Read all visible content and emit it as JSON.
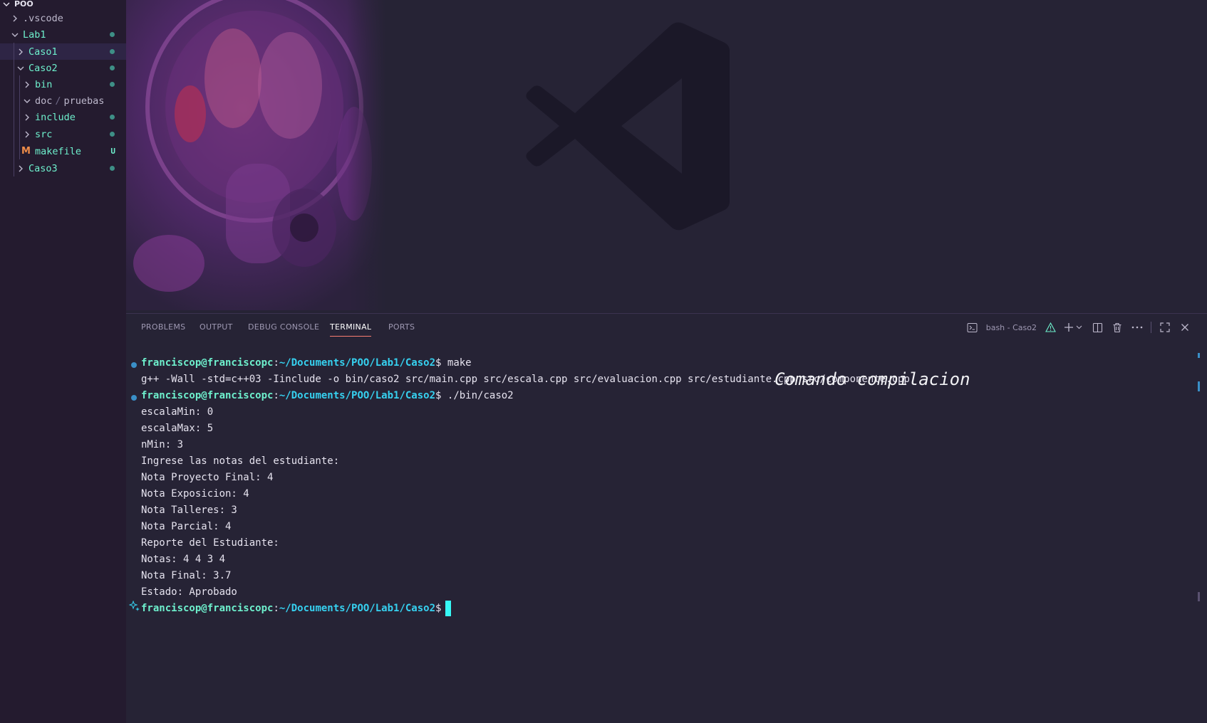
{
  "explorer": {
    "root": "POO",
    "items": [
      {
        "label": ".vscode",
        "kind": "folder",
        "expanded": false,
        "dim": true,
        "badge": ""
      },
      {
        "label": "Lab1",
        "kind": "folder",
        "expanded": true,
        "dim": false,
        "badge": "dot"
      },
      {
        "label": "Caso1",
        "kind": "folder",
        "expanded": false,
        "dim": false,
        "badge": "dot"
      },
      {
        "label": "Caso2",
        "kind": "folder",
        "expanded": true,
        "dim": false,
        "badge": "dot"
      },
      {
        "label": "bin",
        "kind": "folder",
        "expanded": false,
        "dim": false,
        "badge": "dot"
      },
      {
        "label": "doc",
        "kind": "folder",
        "expanded": true,
        "dim": true,
        "badge": ""
      },
      {
        "label": "include",
        "kind": "folder",
        "expanded": false,
        "dim": false,
        "badge": "dot"
      },
      {
        "label": "src",
        "kind": "folder",
        "expanded": false,
        "dim": false,
        "badge": "dot"
      },
      {
        "label": "makefile",
        "kind": "file",
        "dim": false,
        "badge": "U"
      },
      {
        "label": "Caso3",
        "kind": "folder",
        "expanded": false,
        "dim": false,
        "badge": "dot"
      }
    ],
    "doc_sep": "/",
    "doc_child": "pruebas",
    "makefile_icon": "M"
  },
  "panel": {
    "tabs": [
      "PROBLEMS",
      "OUTPUT",
      "DEBUG CONSOLE",
      "TERMINAL",
      "PORTS"
    ],
    "active_tab": "TERMINAL",
    "terminal_name": "bash - Caso2"
  },
  "terminal": {
    "prompt_user": "franciscop@franciscopc",
    "prompt_path": "~/Documents/POO/Lab1/Caso2",
    "cmd1": "make",
    "compile": "g++ -Wall -std=c++03 -Iinclude -o bin/caso2 src/main.cpp src/escala.cpp src/evaluacion.cpp src/estudiante.cpp src/componente.cpp",
    "cmd2": "./bin/caso2",
    "output": [
      "escalaMin: 0",
      "escalaMax: 5",
      "nMin: 3",
      "Ingrese las notas del estudiante:",
      "Nota Proyecto Final: 4",
      "Nota Exposicion: 4",
      "Nota Talleres: 3",
      "Nota Parcial: 4",
      "Reporte del Estudiante:",
      "Notas: 4 4 3 4",
      "Nota Final: 3.7",
      "Estado: Aprobado"
    ],
    "annotation": "Comando compilacion"
  },
  "colors": {
    "accent": "#6ef0cd",
    "path": "#36d1f0",
    "background": "#262335",
    "sidebar": "#241b2f"
  }
}
